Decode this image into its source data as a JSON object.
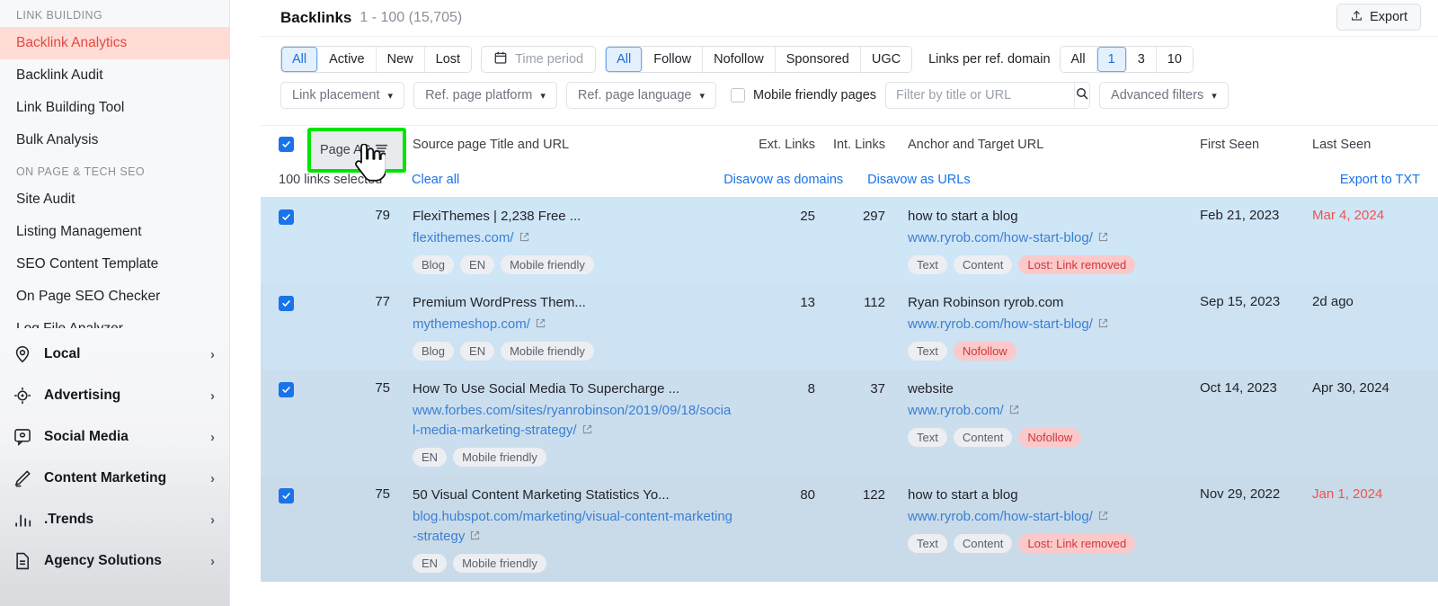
{
  "sidebar": {
    "groups": [
      {
        "label": "LINK BUILDING",
        "items": [
          {
            "label": "Backlink Analytics",
            "active": true
          },
          {
            "label": "Backlink Audit",
            "active": false
          },
          {
            "label": "Link Building Tool",
            "active": false
          },
          {
            "label": "Bulk Analysis",
            "active": false
          }
        ]
      },
      {
        "label": "ON PAGE & TECH SEO",
        "items": [
          {
            "label": "Site Audit",
            "active": false
          },
          {
            "label": "Listing Management",
            "active": false
          },
          {
            "label": "SEO Content Template",
            "active": false
          },
          {
            "label": "On Page SEO Checker",
            "active": false
          },
          {
            "label": "Log File Analyzer",
            "active": false
          }
        ]
      }
    ],
    "categories": [
      {
        "label": "Local",
        "icon": "location-pin-icon",
        "chevron": "›"
      },
      {
        "label": "Advertising",
        "icon": "target-icon",
        "chevron": "›"
      },
      {
        "label": "Social Media",
        "icon": "chat-bubble-icon",
        "chevron": "›"
      },
      {
        "label": "Content Marketing",
        "icon": "pencil-icon",
        "chevron": "›"
      },
      {
        "label": ".Trends",
        "icon": "bar-chart-icon",
        "chevron": "›"
      },
      {
        "label": "Agency Solutions",
        "icon": "document-icon",
        "chevron": "›"
      }
    ]
  },
  "header": {
    "title": "Backlinks",
    "count": "1 - 100 (15,705)",
    "export_label": "Export"
  },
  "filters": {
    "status": {
      "options": [
        "All",
        "Active",
        "New",
        "Lost"
      ],
      "selected": "All"
    },
    "time_period_placeholder": "Time period",
    "link_type": {
      "options": [
        "All",
        "Follow",
        "Nofollow",
        "Sponsored",
        "UGC"
      ],
      "selected": "All"
    },
    "links_per_ref_domain_label": "Links per ref. domain",
    "links_per_ref_domain": {
      "options": [
        "All",
        "1",
        "3",
        "10"
      ],
      "selected": "1"
    },
    "dropdowns": [
      {
        "label": "Link placement"
      },
      {
        "label": "Ref. page platform"
      },
      {
        "label": "Ref. page language"
      }
    ],
    "mobile_friendly_label": "Mobile friendly pages",
    "mobile_friendly_checked": false,
    "search_placeholder": "Filter by title or URL",
    "search_value": "",
    "advanced_filters_label": "Advanced filters"
  },
  "table": {
    "columns": {
      "page_as": "Page AS",
      "source": "Source page Title and URL",
      "ext_links": "Ext. Links",
      "int_links": "Int. Links",
      "anchor": "Anchor and Target URL",
      "first_seen": "First Seen",
      "last_seen": "Last Seen"
    },
    "selection_bar": {
      "selected_text": "100 links selected",
      "clear_all": "Clear all",
      "disavow_domains": "Disavow as domains",
      "disavow_urls": "Disavow as URLs",
      "export_txt": "Export to TXT"
    },
    "rows": [
      {
        "checked": true,
        "page_as": "79",
        "title": "FlexiThemes | 2,238 Free ...",
        "url": "flexithemes.com/",
        "source_tags": [
          {
            "text": "Blog",
            "style": "grey"
          },
          {
            "text": "EN",
            "style": "grey"
          },
          {
            "text": "Mobile friendly",
            "style": "grey"
          }
        ],
        "ext_links": "25",
        "int_links": "297",
        "anchor": "how to start a blog",
        "target_url": "www.ryrob.com/how-start-blog/",
        "anchor_tags": [
          {
            "text": "Text",
            "style": "grey"
          },
          {
            "text": "Content",
            "style": "grey"
          },
          {
            "text": "Lost: Link removed",
            "style": "red"
          }
        ],
        "first_seen": "Feb 21, 2023",
        "last_seen": "Mar 4, 2024",
        "last_seen_lost": true
      },
      {
        "checked": true,
        "page_as": "77",
        "title": "Premium WordPress Them...",
        "url": "mythemeshop.com/",
        "source_tags": [
          {
            "text": "Blog",
            "style": "grey"
          },
          {
            "text": "EN",
            "style": "grey"
          },
          {
            "text": "Mobile friendly",
            "style": "grey"
          }
        ],
        "ext_links": "13",
        "int_links": "112",
        "anchor": "Ryan Robinson ryrob.com",
        "target_url": "www.ryrob.com/how-start-blog/",
        "anchor_tags": [
          {
            "text": "Text",
            "style": "grey"
          },
          {
            "text": "Nofollow",
            "style": "red"
          }
        ],
        "first_seen": "Sep 15, 2023",
        "last_seen": "2d ago",
        "last_seen_lost": false
      },
      {
        "checked": true,
        "page_as": "75",
        "title": "How To Use Social Media To Supercharge ...",
        "url": "www.forbes.com/sites/ryanrobinson/2019/09/18/social-media-marketing-strategy/",
        "source_tags": [
          {
            "text": "EN",
            "style": "grey"
          },
          {
            "text": "Mobile friendly",
            "style": "grey"
          }
        ],
        "ext_links": "8",
        "int_links": "37",
        "anchor": "website",
        "target_url": "www.ryrob.com/",
        "anchor_tags": [
          {
            "text": "Text",
            "style": "grey"
          },
          {
            "text": "Content",
            "style": "grey"
          },
          {
            "text": "Nofollow",
            "style": "red"
          }
        ],
        "first_seen": "Oct 14, 2023",
        "last_seen": "Apr 30, 2024",
        "last_seen_lost": false
      },
      {
        "checked": true,
        "page_as": "75",
        "title": "50 Visual Content Marketing Statistics Yo...",
        "url": "blog.hubspot.com/marketing/visual-content-marketing-strategy",
        "source_tags": [
          {
            "text": "EN",
            "style": "grey"
          },
          {
            "text": "Mobile friendly",
            "style": "grey"
          }
        ],
        "ext_links": "80",
        "int_links": "122",
        "anchor": "how to start a blog",
        "target_url": "www.ryrob.com/how-start-blog/",
        "anchor_tags": [
          {
            "text": "Text",
            "style": "grey"
          },
          {
            "text": "Content",
            "style": "grey"
          },
          {
            "text": "Lost: Link removed",
            "style": "red"
          }
        ],
        "first_seen": "Nov 29, 2022",
        "last_seen": "Jan 1, 2024",
        "last_seen_lost": true
      }
    ]
  },
  "colors": {
    "accent_blue": "#1a73e8",
    "highlight_green": "#00e500",
    "active_nav_bg": "#ffdcd6",
    "active_nav_text": "#e5493f",
    "lost_red": "#ef5350",
    "row_selected_bg": "#cfe6f7"
  }
}
